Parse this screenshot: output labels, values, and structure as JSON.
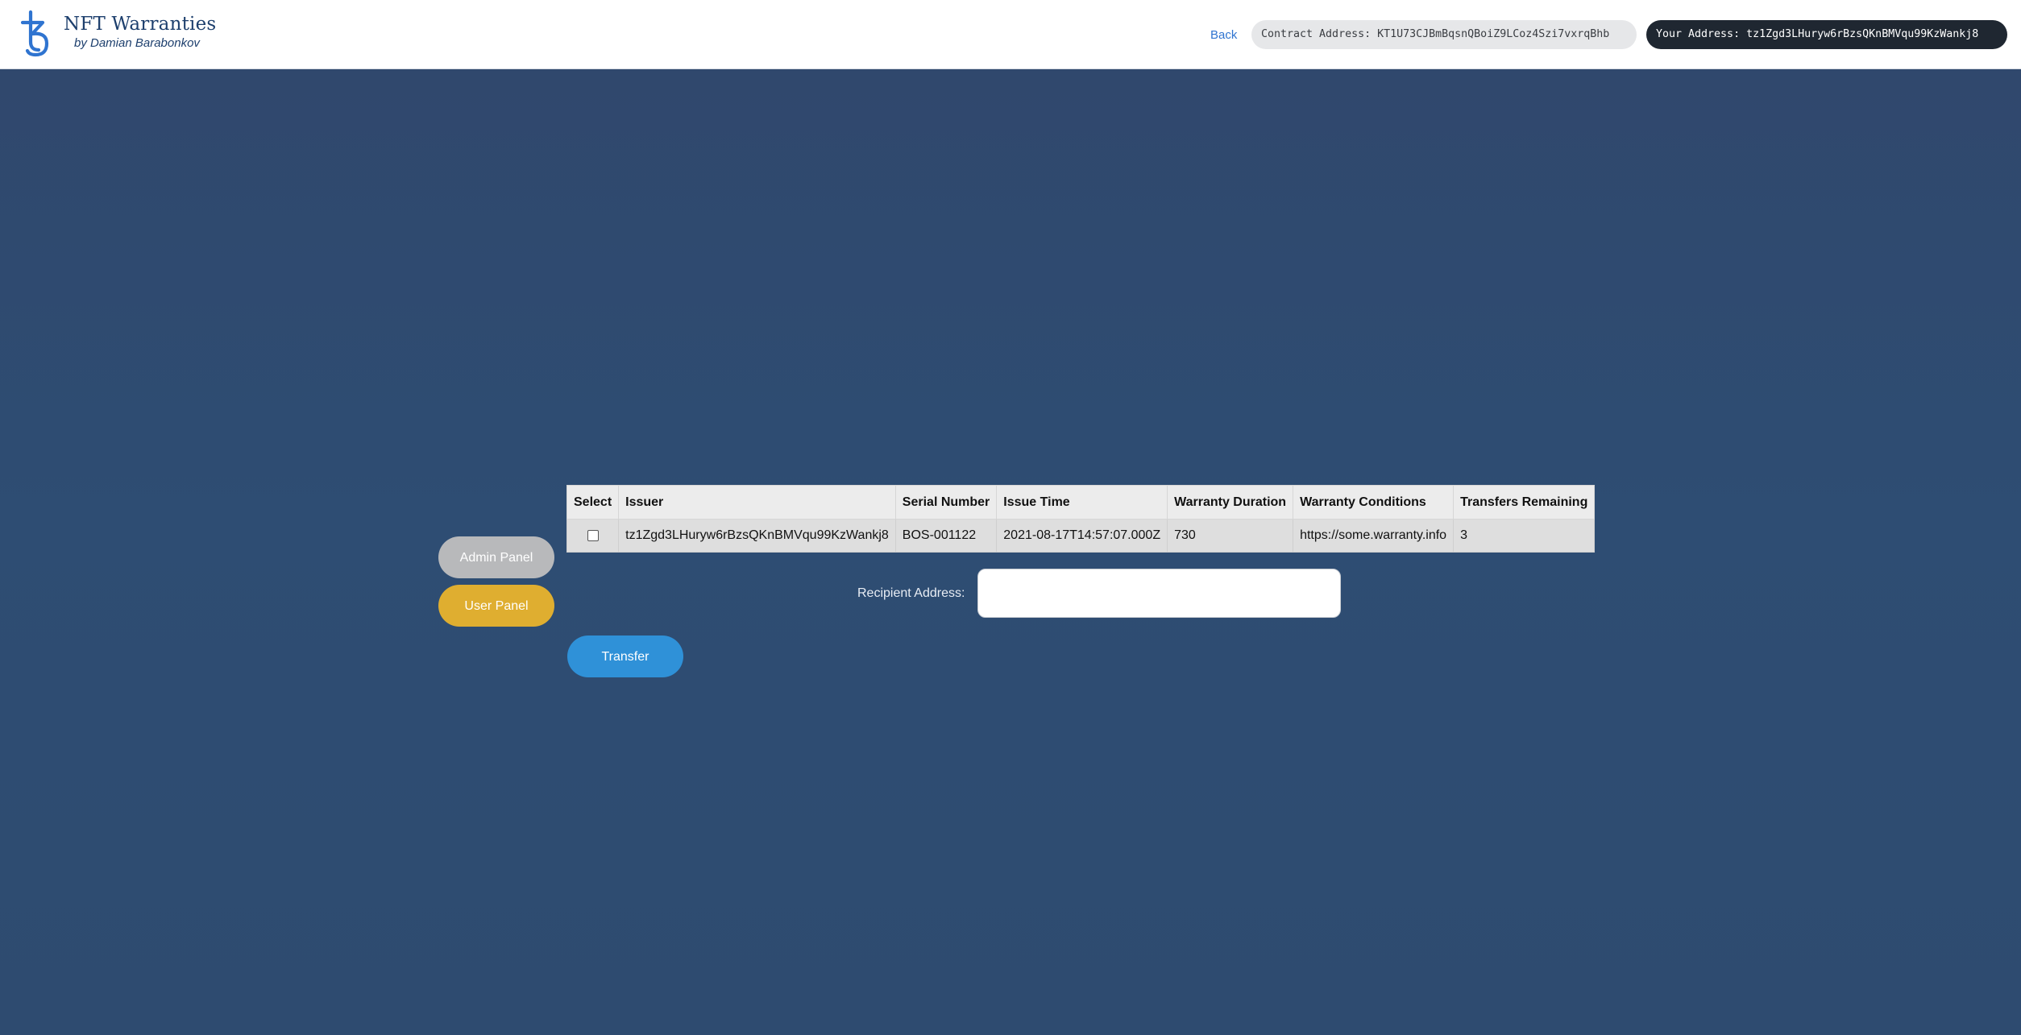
{
  "header": {
    "logo_icon": "tezos-icon",
    "title": "NFT Warranties",
    "subtitle": "by Damian Barabonkov",
    "back_label": "Back",
    "contract_address": "Contract Address: KT1U73CJBmBqsnQBoiZ9LCoz4Szi7vxrqBhb",
    "user_address": "Your Address: tz1Zgd3LHuryw6rBzsQKnBMVqu99KzWankj8"
  },
  "sidebar": {
    "admin_label": "Admin Panel",
    "user_label": "User Panel"
  },
  "table": {
    "headers": [
      "Select",
      "Issuer",
      "Serial Number",
      "Issue Time",
      "Warranty Duration",
      "Warranty Conditions",
      "Transfers Remaining"
    ],
    "rows": [
      {
        "selected": false,
        "issuer": "tz1Zgd3LHuryw6rBzsQKnBMVqu99KzWankj8",
        "serial_number": "BOS-001122",
        "issue_time": "2021-08-17T14:57:07.000Z",
        "warranty_duration": "730",
        "warranty_conditions": "https://some.warranty.info",
        "transfers_remaining": "3"
      }
    ]
  },
  "transfer_form": {
    "recipient_label": "Recipient Address:",
    "recipient_value": "",
    "transfer_label": "Transfer"
  },
  "colors": {
    "background": "#2e4b70",
    "admin_button": "#b8b9bb",
    "user_button": "#dfae30",
    "transfer_button": "#2f91d8",
    "brand": "#1d3f6d"
  }
}
